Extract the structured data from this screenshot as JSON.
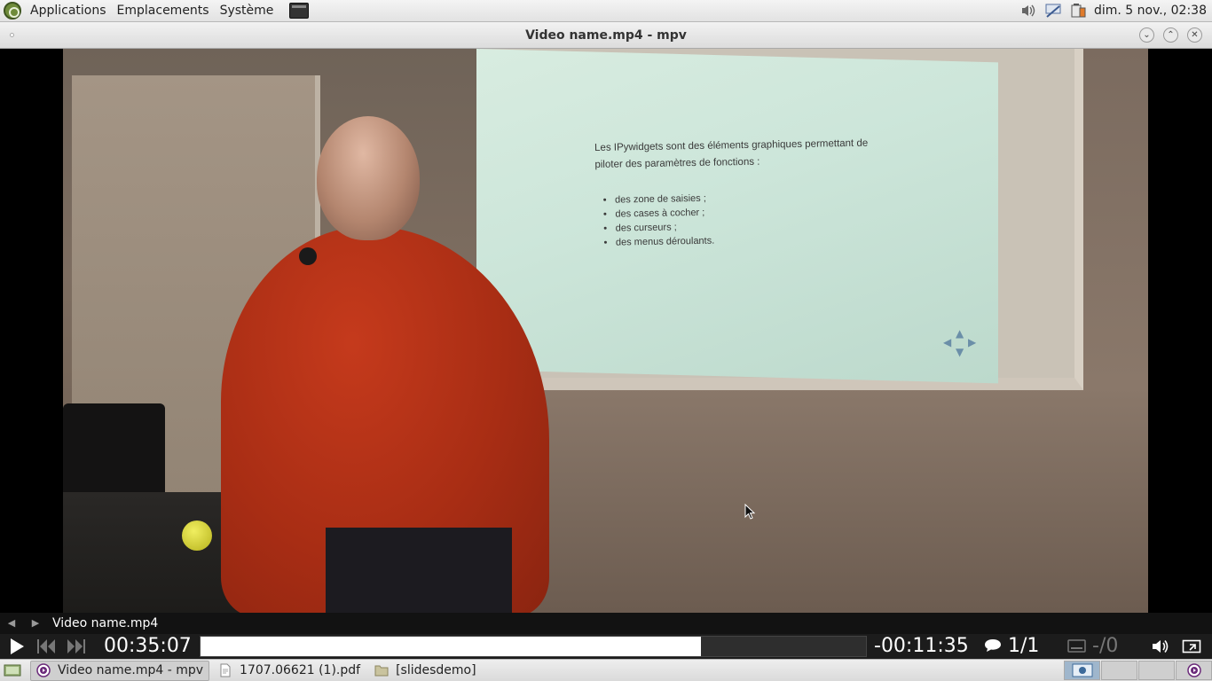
{
  "top_panel": {
    "menus": [
      "Applications",
      "Emplacements",
      "Système"
    ],
    "clock": "dim.  5 nov., 02:38"
  },
  "window": {
    "title": "Video name.mp4 - mpv"
  },
  "slide": {
    "intro": "Les IPywidgets sont des éléments graphiques permettant de piloter des paramètres de fonctions :",
    "bullets": [
      "des zone de saisies ;",
      "des cases à cocher ;",
      "des curseurs ;",
      "des menus déroulants."
    ]
  },
  "player": {
    "playlist_title": "Video name.mp4",
    "elapsed": "00:35:07",
    "remaining": "-00:11:35",
    "progress": 0.752,
    "subtitle_track": "1/1",
    "audio_track": "-/0"
  },
  "taskbar": {
    "tasks": [
      {
        "label": "Video name.mp4 - mpv",
        "icon": "mpv-icon"
      },
      {
        "label": "1707.06621 (1).pdf",
        "icon": "document-icon"
      },
      {
        "label": "[slidesdemo]",
        "icon": "folder-icon"
      }
    ]
  }
}
